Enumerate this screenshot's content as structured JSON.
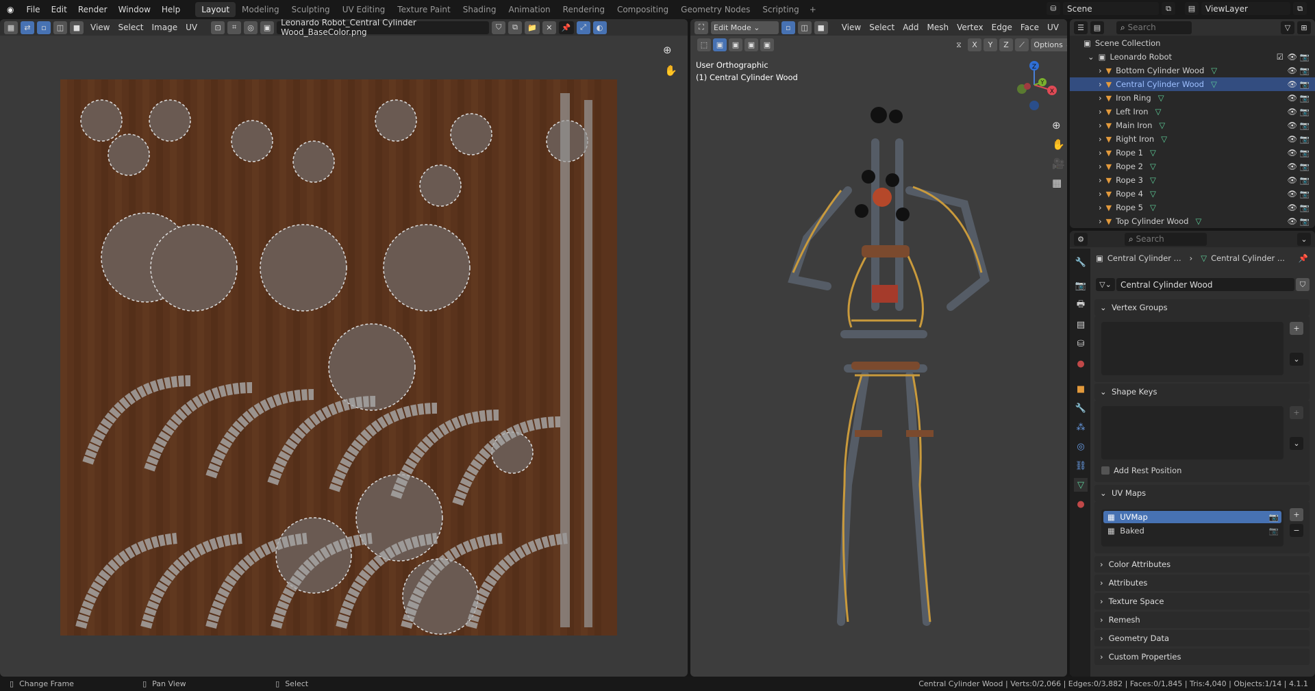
{
  "top_menu": [
    "File",
    "Edit",
    "Render",
    "Window",
    "Help"
  ],
  "workspaces": [
    "Layout",
    "Modeling",
    "Sculpting",
    "UV Editing",
    "Texture Paint",
    "Shading",
    "Animation",
    "Rendering",
    "Compositing",
    "Geometry Nodes",
    "Scripting"
  ],
  "active_workspace": "Layout",
  "scene": "Scene",
  "view_layer": "ViewLayer",
  "uv_editor": {
    "menus": [
      "View",
      "Select",
      "Image",
      "UV"
    ],
    "image_name": "Leonardo Robot_Central Cylinder Wood_BaseColor.png"
  },
  "viewport": {
    "mode": "Edit Mode",
    "menus": [
      "View",
      "Select",
      "Add",
      "Mesh",
      "Vertex",
      "Edge",
      "Face",
      "UV"
    ],
    "axes": [
      "X",
      "Y",
      "Z"
    ],
    "options": "Options",
    "view_name": "User Orthographic",
    "object_label": "(1) Central Cylinder Wood",
    "gizmo": {
      "z": "Z",
      "y": "Y",
      "x": "X"
    }
  },
  "outliner": {
    "search_placeholder": "Search",
    "scene_collection": "Scene Collection",
    "collection": "Leonardo Robot",
    "items": [
      {
        "name": "Bottom Cylinder Wood",
        "selected": false
      },
      {
        "name": "Central Cylinder Wood",
        "selected": true
      },
      {
        "name": "Iron Ring",
        "selected": false
      },
      {
        "name": "Left Iron",
        "selected": false
      },
      {
        "name": "Main Iron",
        "selected": false
      },
      {
        "name": "Right Iron",
        "selected": false
      },
      {
        "name": "Rope 1",
        "selected": false
      },
      {
        "name": "Rope 2",
        "selected": false
      },
      {
        "name": "Rope 3",
        "selected": false
      },
      {
        "name": "Rope 4",
        "selected": false
      },
      {
        "name": "Rope 5",
        "selected": false
      },
      {
        "name": "Top Cylinder Wood",
        "selected": false
      }
    ]
  },
  "properties": {
    "search_placeholder": "Search",
    "breadcrumb_object": "Central Cylinder ...",
    "breadcrumb_mesh": "Central Cylinder ...",
    "mesh_name": "Central Cylinder Wood",
    "vertex_groups": "Vertex Groups",
    "shape_keys": "Shape Keys",
    "add_rest_position": "Add Rest Position",
    "uv_maps": "UV Maps",
    "uv_map_items": [
      "UVMap",
      "Baked"
    ],
    "collapsed_sections": [
      "Color Attributes",
      "Attributes",
      "Texture Space",
      "Remesh",
      "Geometry Data",
      "Custom Properties"
    ]
  },
  "status": {
    "left": [
      "Change Frame",
      "Pan View",
      "Select"
    ],
    "stats": "Central Cylinder Wood | Verts:0/2,066 | Edges:0/3,882 | Faces:0/1,845 | Tris:4,040 | Objects:1/14 | 4.1.1"
  },
  "colors": {
    "accent": "#4772b3",
    "selection": "#334d80",
    "wood": "#6b3e22"
  }
}
